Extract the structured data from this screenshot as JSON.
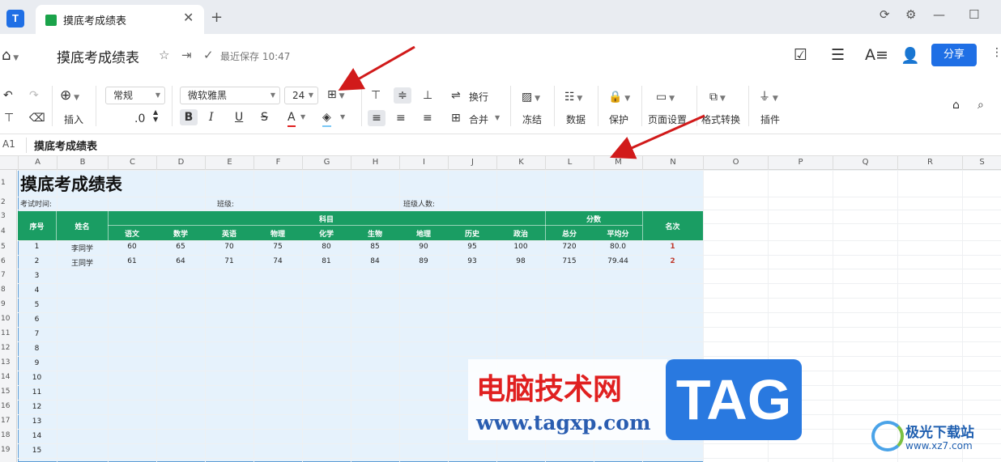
{
  "tab": {
    "title": "摸底考成绩表",
    "close": "✕",
    "new": "+"
  },
  "window": {
    "refresh": "⟳",
    "settings": "⚙",
    "minimize": "—",
    "maximize": "☐"
  },
  "titlebar": {
    "doc_title": "摸底考成绩表",
    "save_status": "最近保存 10:47",
    "share_label": "分享"
  },
  "toolbar": {
    "insert_label": "插入",
    "format_value": "常规",
    "decimal_label": ".0",
    "font_name": "微软雅黑",
    "font_size": "24",
    "wrap_label": "换行",
    "merge_label": "合并",
    "freeze_label": "冻结",
    "data_label": "数据",
    "protect_label": "保护",
    "page_setup_label": "页面设置",
    "format_convert_label": "格式转换",
    "plugin_label": "插件",
    "bold": "B",
    "italic": "I",
    "underline": "U",
    "strike": "S",
    "font_color": "A"
  },
  "formula": {
    "cell_ref": "A1",
    "content": "摸底考成绩表"
  },
  "columns": [
    "A",
    "B",
    "C",
    "D",
    "E",
    "F",
    "G",
    "H",
    "I",
    "J",
    "K",
    "L",
    "M",
    "N",
    "O",
    "P",
    "Q",
    "R",
    "S"
  ],
  "rows": [
    "1",
    "2",
    "3",
    "4",
    "5",
    "6",
    "7",
    "8",
    "9",
    "10",
    "11",
    "12",
    "13",
    "14",
    "15",
    "16",
    "17",
    "18",
    "19"
  ],
  "sheet": {
    "title": "摸底考成绩表",
    "exam_time_label": "考试时间:",
    "class_label": "班级:",
    "class_count_label": "班级人数:",
    "header": {
      "seq": "序号",
      "name": "姓名",
      "subjects": "科目",
      "scores": "分数",
      "rank": "名次",
      "subject_cols": [
        "语文",
        "数学",
        "英语",
        "物理",
        "化学",
        "生物",
        "地理",
        "历史",
        "政治"
      ],
      "score_cols": [
        "总分",
        "平均分"
      ]
    },
    "records": [
      {
        "seq": "1",
        "name": "李同学",
        "scores": [
          "60",
          "65",
          "70",
          "75",
          "80",
          "85",
          "90",
          "95",
          "100"
        ],
        "total": "720",
        "avg": "80.0",
        "rank": "1"
      },
      {
        "seq": "2",
        "name": "王同学",
        "scores": [
          "61",
          "64",
          "71",
          "74",
          "81",
          "84",
          "89",
          "93",
          "98"
        ],
        "total": "715",
        "avg": "79.44",
        "rank": "2"
      }
    ],
    "seq_more": [
      "3",
      "4",
      "5",
      "6",
      "7",
      "8",
      "9",
      "10",
      "11",
      "12",
      "13",
      "14",
      "15"
    ]
  },
  "watermark": {
    "cn": "电脑技术网",
    "url": "www.tagxp.com",
    "tag": "TAG",
    "site2": "极光下载站",
    "site2_url": "www.xz7.com"
  },
  "colors": {
    "accent": "#1f6fe5",
    "header_green": "#1a9d63",
    "selection": "#e6f2fc",
    "arrow": "#d11a1a"
  }
}
